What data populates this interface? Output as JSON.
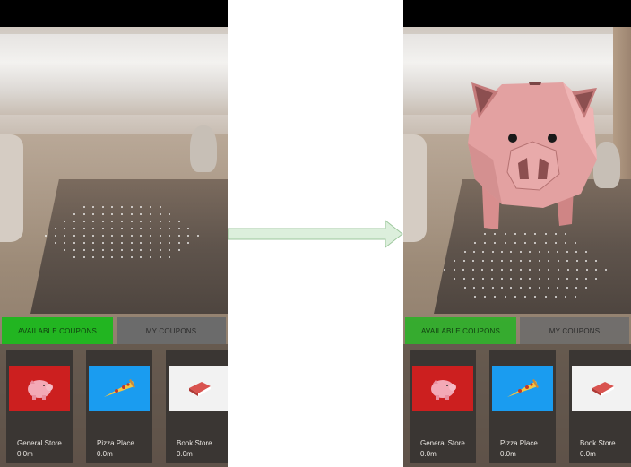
{
  "tabs": {
    "available_label": "AVAILABLE COUPONS",
    "my_label": "MY COUPONS",
    "active_color": "#22b521",
    "inactive_color": "#6b6b6b"
  },
  "coupons": [
    {
      "name": "General Store",
      "distance": "0.0m",
      "icon": "piggy-bank-icon",
      "bg": "#cc1f1f"
    },
    {
      "name": "Pizza Place",
      "distance": "0.0m",
      "icon": "pizza-slice-icon",
      "bg": "#1a9cf0"
    },
    {
      "name": "Book Store",
      "distance": "0.0m",
      "icon": "book-icon",
      "bg": "#f2f2f2"
    }
  ],
  "transition": {
    "icon": "right-arrow-icon",
    "color": "#d8ecd8"
  },
  "ar_object": {
    "icon": "piggy-bank-3d-model"
  }
}
